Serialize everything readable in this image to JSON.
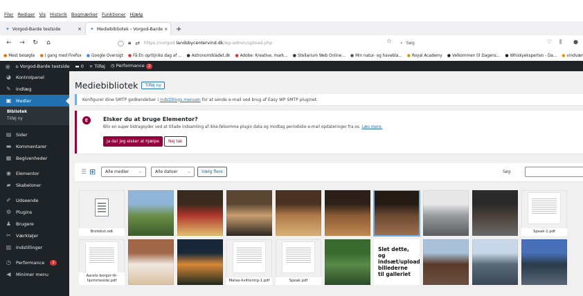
{
  "browser": {
    "menu": [
      "Filer",
      "Rediger",
      "Vis",
      "Historik",
      "Bogmærker",
      "Funktioner",
      "Hjælp"
    ],
    "tabs": [
      {
        "label": "Vorgod-Barde testside",
        "close": "×"
      },
      {
        "label": "Mediebibliotek ‹ Vorgod-Barde ×",
        "close": "×"
      }
    ],
    "new_tab": "+",
    "url_prefix": "https://vorgod.",
    "url_domain": "landsbycentervind.dk",
    "url_path": "/wp-admin/upload.php",
    "search_placeholder": "Søg",
    "bookmarks": [
      "Mest besøgte",
      "I gang med Firefox",
      "Google Oversigt",
      "Få En oprtijniks dag af ...",
      "Astronomibladet.dk",
      "Adobe: Kreative, mark...",
      "Stellarium Web Online...",
      "Min natur- og havebla...",
      "Royal Academy",
      "Velkommen til Dagens...",
      "Whiskyeksperten - Da...",
      "vindværket"
    ]
  },
  "adminbar": {
    "site": "Vorgod-Barde testside",
    "comments": "0",
    "new": "Tilføj",
    "performance": "Performance",
    "performance_count": "2"
  },
  "sidebar": {
    "items": [
      {
        "label": "Kontrolpanel",
        "icon": "dashboard-icon",
        "glyph": "◕"
      },
      {
        "label": "Indlæg",
        "icon": "pin-icon",
        "glyph": "✎"
      },
      {
        "label": "Medier",
        "icon": "media-icon",
        "glyph": "▣",
        "active": true
      },
      {
        "label": "Sider",
        "icon": "pages-icon",
        "glyph": "▤"
      },
      {
        "label": "Kommentarer",
        "icon": "comments-icon",
        "glyph": "▬"
      },
      {
        "label": "Begivenheder",
        "icon": "calendar-icon",
        "glyph": "▦"
      },
      {
        "label": "Elementor",
        "icon": "elementor-icon",
        "glyph": "◉"
      },
      {
        "label": "Skabeloner",
        "icon": "folder-icon",
        "glyph": "▰"
      },
      {
        "label": "Udseende",
        "icon": "brush-icon",
        "glyph": "✐"
      },
      {
        "label": "Plugins",
        "icon": "plugin-icon",
        "glyph": "⚙"
      },
      {
        "label": "Brugere",
        "icon": "users-icon",
        "glyph": "♟"
      },
      {
        "label": "Værktøjer",
        "icon": "tools-icon",
        "glyph": "✂"
      },
      {
        "label": "Indstillinger",
        "icon": "settings-icon",
        "glyph": "▥"
      },
      {
        "label": "Performance",
        "icon": "performance-icon",
        "glyph": "◷",
        "badge": "2"
      },
      {
        "label": "Minimer menu",
        "icon": "collapse-icon",
        "glyph": "◀"
      }
    ],
    "submenu": [
      "Bibliotek",
      "Tilføj ny"
    ]
  },
  "page": {
    "title": "Mediebibliotek",
    "add_new": "Tilføj ny",
    "notice_pre": "Konfigurer dine SMTP godkendelser i",
    "notice_link": "indstillings menuen",
    "notice_post": "for at sende e-mail ved brug af Easy WP SMTP pluginet.",
    "elementor_title": "Elsker du at bruge Elementor?",
    "elementor_desc": "Bliv en super bidragsyder ved at tillade indsamling af ikke-følsomme plugin data og modtag periodiske e-mail opdateringer fra os.",
    "elementor_link": "Læs mere.",
    "btn_yes": "Ja da! Jeg elsker at hjælpe",
    "btn_no": "Nej tak",
    "filter_media": "Alle medier",
    "filter_dates": "Alle datoer",
    "bulk_select": "Vælg flere",
    "search_label": "Søg"
  },
  "media": [
    {
      "kind": "doc",
      "caption": "Brotekst.odt"
    },
    {
      "kind": "photo",
      "colors": [
        "#8fb6d8",
        "#6e8f4a",
        "#3d5a2a"
      ]
    },
    {
      "kind": "photo",
      "colors": [
        "#3a2a1e",
        "#b0352a",
        "#e0c070"
      ]
    },
    {
      "kind": "photo",
      "colors": [
        "#5a4632",
        "#c8a070",
        "#2e2620"
      ]
    },
    {
      "kind": "photo",
      "colors": [
        "#4a3222",
        "#b07a48",
        "#d8b078"
      ]
    },
    {
      "kind": "photo",
      "colors": [
        "#2c2018",
        "#8a5a34",
        "#c08a50"
      ]
    },
    {
      "kind": "photo",
      "colors": [
        "#241a14",
        "#6a4a30",
        "#a07050"
      ],
      "selected": true
    },
    {
      "kind": "photo",
      "colors": [
        "#e8e8e8",
        "#9a9ca0",
        "#5a5c60"
      ]
    },
    {
      "kind": "photo",
      "colors": [
        "#2a2a2a",
        "#4a4038",
        "#6a6a6a"
      ]
    },
    {
      "kind": "pdf",
      "caption": "Speak-1.pdf"
    },
    {
      "kind": "pdf",
      "caption": "Aarets-borger-til-hjemmeside.pdf"
    },
    {
      "kind": "photo",
      "colors": [
        "#a06848",
        "#f0e8e0",
        "#d8c0a0"
      ]
    },
    {
      "kind": "photo",
      "colors": [
        "#182838",
        "#d88838",
        "#202820"
      ]
    },
    {
      "kind": "pdf",
      "caption": "Matas-kvittering-1.pdf"
    },
    {
      "kind": "pdf",
      "caption": "Speak.pdf"
    },
    {
      "kind": "photo",
      "colors": [
        "#3a6a30",
        "#5a8a48",
        "#2a4a28"
      ]
    },
    {
      "kind": "text",
      "text": "Slet dette, og indsæt/upload billederne til galleriet"
    },
    {
      "kind": "photo",
      "colors": [
        "#a8c0d8",
        "#5a3a2a",
        "#6a5040"
      ]
    },
    {
      "kind": "photo",
      "colors": [
        "#c8d8e8",
        "#5a6a78",
        "#384858"
      ]
    },
    {
      "kind": "photo",
      "colors": [
        "#4870b8",
        "#2a3a48",
        "#586878"
      ]
    }
  ]
}
